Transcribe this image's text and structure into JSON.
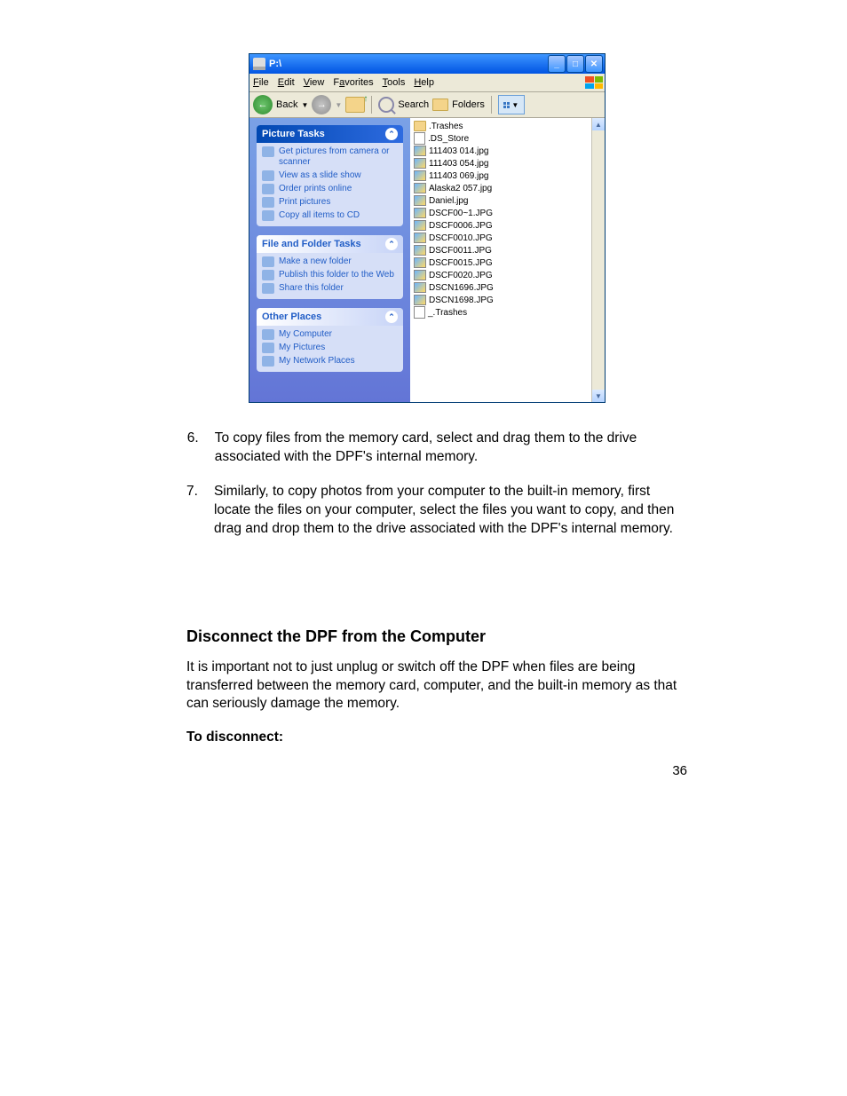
{
  "window": {
    "title": "P:\\",
    "menubar": {
      "file": "File",
      "edit": "Edit",
      "view": "View",
      "favorites": "Favorites",
      "tools": "Tools",
      "help": "Help"
    },
    "toolbar": {
      "back": "Back",
      "search": "Search",
      "folders": "Folders"
    },
    "taskpane": {
      "picture": {
        "title": "Picture Tasks",
        "items": [
          "Get pictures from camera or scanner",
          "View as a slide show",
          "Order prints online",
          "Print pictures",
          "Copy all items to CD"
        ]
      },
      "file": {
        "title": "File and Folder Tasks",
        "items": [
          "Make a new folder",
          "Publish this folder to the Web",
          "Share this folder"
        ]
      },
      "other": {
        "title": "Other Places",
        "items": [
          "My Computer",
          "My Pictures",
          "My Network Places"
        ]
      }
    },
    "files": [
      {
        "type": "folder",
        "name": ".Trashes"
      },
      {
        "type": "file",
        "name": ".DS_Store"
      },
      {
        "type": "img",
        "name": "111403 014.jpg"
      },
      {
        "type": "img",
        "name": "111403 054.jpg"
      },
      {
        "type": "img",
        "name": "111403 069.jpg"
      },
      {
        "type": "img",
        "name": "Alaska2 057.jpg"
      },
      {
        "type": "img",
        "name": "Daniel.jpg"
      },
      {
        "type": "img",
        "name": "DSCF00~1.JPG"
      },
      {
        "type": "img",
        "name": "DSCF0006.JPG"
      },
      {
        "type": "img",
        "name": "DSCF0010.JPG"
      },
      {
        "type": "img",
        "name": "DSCF0011.JPG"
      },
      {
        "type": "img",
        "name": "DSCF0015.JPG"
      },
      {
        "type": "img",
        "name": "DSCF0020.JPG"
      },
      {
        "type": "img",
        "name": "DSCN1696.JPG"
      },
      {
        "type": "img",
        "name": "DSCN1698.JPG"
      },
      {
        "type": "file",
        "name": "_.Trashes"
      }
    ]
  },
  "doc": {
    "step6_num": "6.",
    "step6": "To copy files from the memory card, select and drag them to the drive associated with the DPF's internal memory.",
    "step7_num": "7.",
    "step7": "Similarly, to copy photos from your computer to the built-in memory, first locate the files on your computer, select the files you want to copy, and then drag and drop them to the drive associated with the DPF's internal memory.",
    "heading": "Disconnect the DPF from the Computer",
    "para": "It is important not to just unplug or switch off the DPF when files are being transferred between the memory card, computer, and the built-in memory as that can seriously damage the memory.",
    "bold": "To disconnect:",
    "pagenum": "36"
  }
}
